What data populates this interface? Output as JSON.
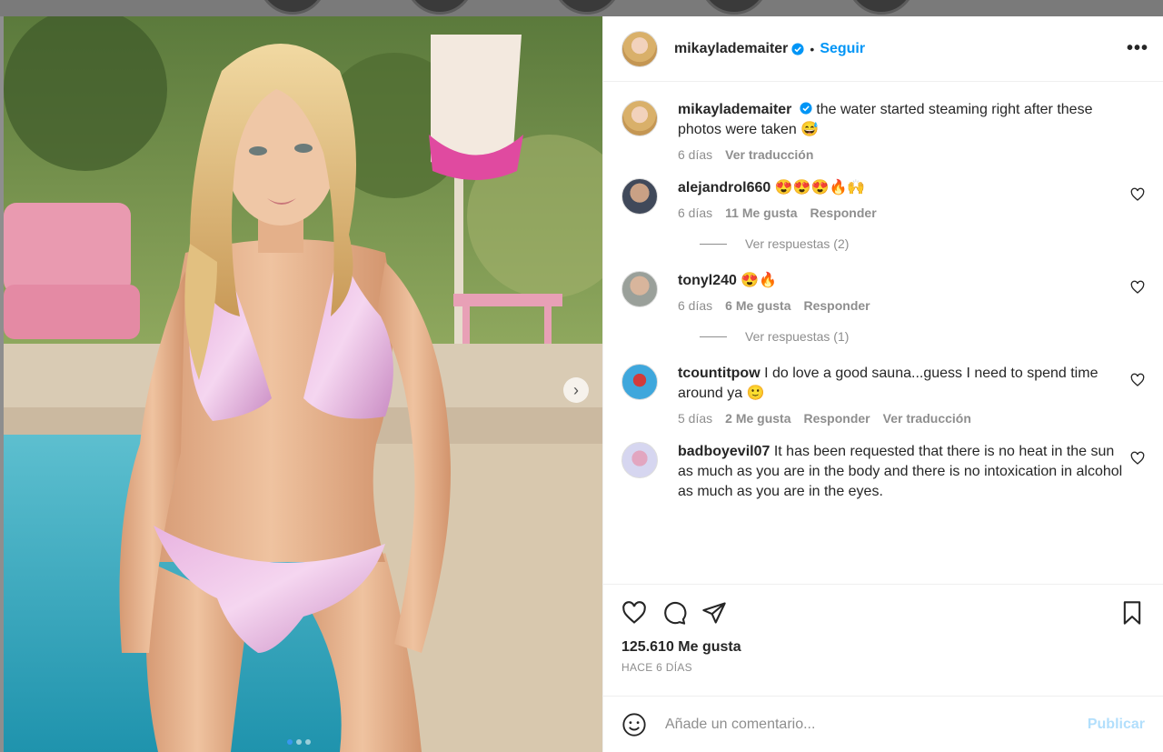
{
  "post": {
    "author": {
      "username": "mikaylademaiter",
      "follow_label": "Seguir",
      "more_icon": "more-horizontal-icon"
    },
    "caption": {
      "username": "mikaylademaiter",
      "text": "the water started steaming right after these photos were taken 😅",
      "age": "6 días",
      "translate_label": "Ver traducción"
    },
    "comments": [
      {
        "username": "alejandrol660",
        "text": "😍😍😍🔥🙌",
        "age": "6 días",
        "likes": "11 Me gusta",
        "reply_label": "Responder",
        "replies_label": "Ver respuestas (2)"
      },
      {
        "username": "tonyl240",
        "text": "😍🔥",
        "age": "6 días",
        "likes": "6 Me gusta",
        "reply_label": "Responder",
        "replies_label": "Ver respuestas (1)"
      },
      {
        "username": "tcountitpow",
        "text": "I do love a good sauna...guess I need to spend time around ya 🙂",
        "age": "5 días",
        "likes": "2 Me gusta",
        "reply_label": "Responder",
        "translate_label": "Ver traducción"
      },
      {
        "username": "badboyevil07",
        "text": "It has been requested that there is no heat in the sun as much as you are in the body and there is no intoxication in alcohol as much as you are in the eyes."
      }
    ],
    "likes_count": "125.610 Me gusta",
    "time_ago": "HACE 6 DÍAS",
    "comment_input": {
      "placeholder": "Añade un comentario...",
      "publish_label": "Publicar"
    },
    "carousel": {
      "total": 3,
      "active": 1
    }
  },
  "colors": {
    "accent": "#0095f6",
    "publish_disabled": "#b2dffc",
    "muted": "#8e8e8e",
    "text": "#262626"
  }
}
